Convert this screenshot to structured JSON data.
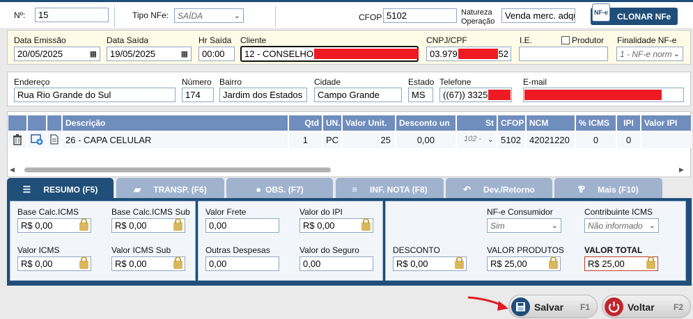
{
  "header": {
    "numero_label": "Nº:",
    "numero_value": "15",
    "tipo_nfe_label": "Tipo NFe:",
    "tipo_nfe_value": "SAÍDA",
    "cfop_label": "CFOP",
    "cfop_value": "5102",
    "natureza_label_1": "Natureza",
    "natureza_label_2": "Operação",
    "natureza_value": "Venda merc. adqu",
    "clonar_label": "CLONAR NFe",
    "nfe_badge": "NF-e"
  },
  "dest": {
    "data_emissao_label": "Data Emissão",
    "data_emissao_value": "20/05/2025",
    "data_saida_label": "Data Saída",
    "data_saida_value": "19/05/2025",
    "hr_saida_label": "Hr Saída",
    "hr_saida_value": "00:00",
    "cliente_label": "Cliente",
    "cliente_value": "12 - CONSELHO",
    "cnpj_label": "CNPJ/CPF",
    "cnpj_prefix": "03.979",
    "cnpj_suffix": "52",
    "ie_label": "I.E.",
    "ie_value": "",
    "produtor_label": "Produtor",
    "finalidade_label": "Finalidade NF-e",
    "finalidade_value": "1 - NF-e norm"
  },
  "address": {
    "endereco_label": "Endereço",
    "endereco_value": "Rua Rio Grande do Sul",
    "numero_label": "Número",
    "numero_value": "174",
    "bairro_label": "Bairro",
    "bairro_value": "Jardim dos Estados",
    "cidade_label": "Cidade",
    "cidade_value": "Campo Grande",
    "estado_label": "Estado",
    "estado_value": "MS",
    "telefone_label": "Telefone",
    "telefone_value": "((67)) 3325",
    "email_label": "E-mail"
  },
  "items": {
    "columns": [
      "Descrição",
      "Qtd",
      "UN.",
      "Valor Unit.",
      "Desconto un",
      "St",
      "CFOP",
      "NCM",
      "% ICMS",
      "IPI",
      "Valor IPI"
    ],
    "rows": [
      {
        "descricao": "26 - CAPA CELULAR",
        "qtd": "1",
        "un": "PC",
        "valor_unit": "25",
        "desconto": "0,00",
        "st": "102 -",
        "cfop": "5102",
        "ncm": "42021220",
        "icms": "0",
        "ipi": "0",
        "valor_ipi": ""
      }
    ]
  },
  "tabs": [
    {
      "label": "RESUMO (F5)",
      "icon": "list-icon",
      "active": true
    },
    {
      "label": "TRANSP. (F6)",
      "icon": "truck-icon",
      "active": false
    },
    {
      "label": "OBS. (F7)",
      "icon": "chat-icon",
      "active": false
    },
    {
      "label": "INF. NOTA (F8)",
      "icon": "database-icon",
      "active": false
    },
    {
      "label": "Dev./Retorno",
      "icon": "reply-icon",
      "active": false
    },
    {
      "label": "Mais (F10)",
      "icon": "fork-icon",
      "active": false
    }
  ],
  "resumo": {
    "base_calc_icms_label": "Base Calc.ICMS",
    "base_calc_icms_value": "R$ 0,00",
    "base_calc_icms_sub_label": "Base Calc.ICMS Sub",
    "base_calc_icms_sub_value": "R$ 0,00",
    "valor_icms_label": "Valor ICMS",
    "valor_icms_value": "R$ 0,00",
    "valor_icms_sub_label": "Valor ICMS Sub",
    "valor_icms_sub_value": "R$ 0,00",
    "valor_frete_label": "Valor Frete",
    "valor_frete_value": "0,00",
    "valor_ipi_label": "Valor do IPI",
    "valor_ipi_value": "R$ 0,00",
    "outras_label": "Outras Despesas",
    "outras_value": "0,00",
    "seguro_label": "Valor do Seguro",
    "seguro_value": "0,00",
    "nfe_consumidor_label": "NF-e Consumidor",
    "nfe_consumidor_value": "Sim",
    "contribuinte_label": "Contribuinte ICMS",
    "contribuinte_value": "Não informado",
    "desconto_label": "DESCONTO",
    "desconto_value": "R$ 0,00",
    "valor_produtos_label": "VALOR PRODUTOS",
    "valor_produtos_value": "R$ 25,00",
    "valor_total_label": "VALOR TOTAL",
    "valor_total_value": "R$ 25,00"
  },
  "footer": {
    "salvar_label": "Salvar",
    "salvar_key": "F1",
    "voltar_label": "Voltar",
    "voltar_key": "F2"
  },
  "colors": {
    "accent": "#1f4e79",
    "grid_header": "#6f8dbd",
    "redaction": "#ee1b24",
    "total_border": "#c0392b"
  }
}
